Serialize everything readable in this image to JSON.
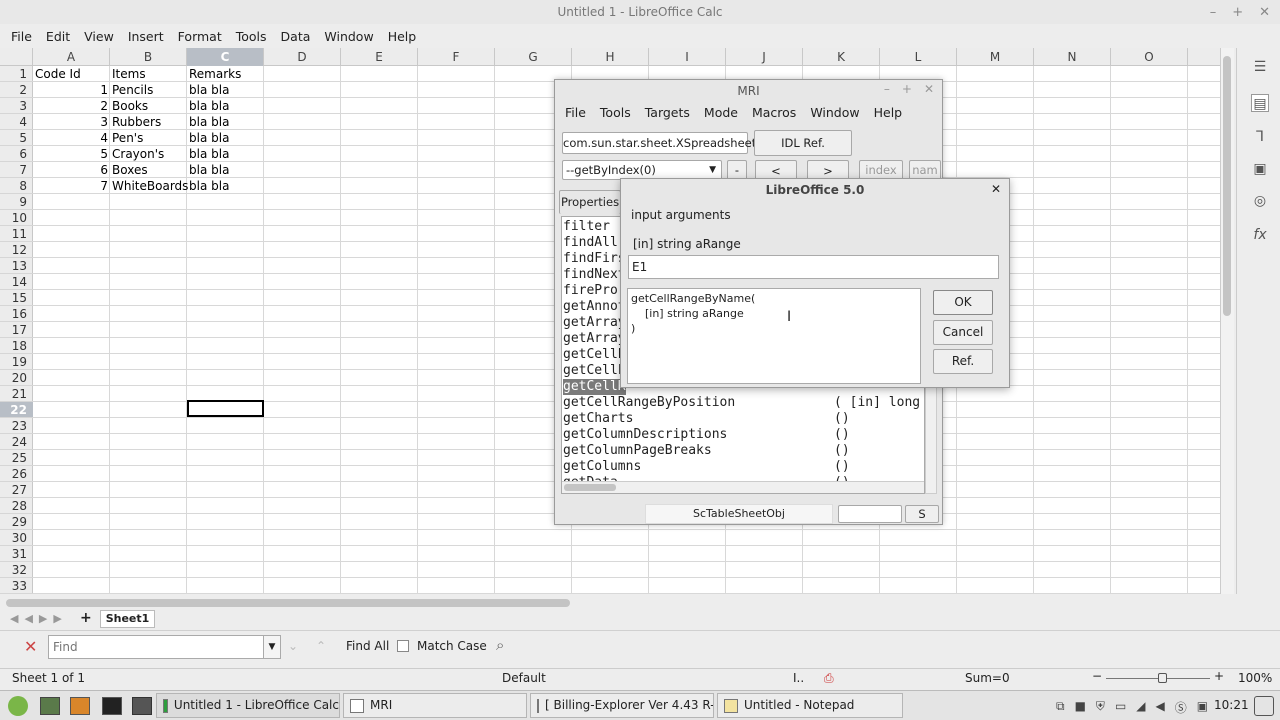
{
  "window": {
    "title": "Untitled 1 - LibreOffice Calc"
  },
  "menu": [
    "File",
    "Edit",
    "View",
    "Insert",
    "Format",
    "Tools",
    "Data",
    "Window",
    "Help"
  ],
  "columns": [
    "A",
    "B",
    "C",
    "D",
    "E",
    "F",
    "G",
    "H",
    "I",
    "J",
    "K",
    "L",
    "M",
    "N",
    "O"
  ],
  "selected_column": "C",
  "rows": [
    "1",
    "2",
    "3",
    "4",
    "5",
    "6",
    "7",
    "8",
    "9",
    "10",
    "11",
    "12",
    "13",
    "14",
    "15",
    "16",
    "17",
    "18",
    "19",
    "20",
    "21",
    "22",
    "23",
    "24",
    "25",
    "26",
    "27",
    "28",
    "29",
    "30",
    "31",
    "32",
    "33"
  ],
  "selected_row": "22",
  "sheet": {
    "headers": [
      "Code Id",
      "Items",
      "Remarks"
    ],
    "data": [
      [
        "1",
        "Pencils",
        "bla bla"
      ],
      [
        "2",
        "Books",
        "bla bla"
      ],
      [
        "3",
        "Rubbers",
        "bla bla"
      ],
      [
        "4",
        "Pen's",
        "bla bla"
      ],
      [
        "5",
        "Crayon's",
        "bla bla"
      ],
      [
        "6",
        "Boxes",
        "bla bla"
      ],
      [
        "7",
        "WhiteBoards",
        "bla bla"
      ]
    ]
  },
  "mri": {
    "title": "MRI",
    "menu": [
      "File",
      "Tools",
      "Targets",
      "Mode",
      "Macros",
      "Window",
      "Help"
    ],
    "type_name": "com.sun.star.sheet.XSpreadsheet",
    "idl_ref": "IDL Ref.",
    "combo": "--getByIndex(0)",
    "minus": "-",
    "nav_back": "<",
    "nav_fwd": ">",
    "index_btn": "index",
    "name_btn": "nam",
    "tab": "Properties",
    "list_left": [
      "filter",
      "findAll",
      "findFirs",
      "findNext",
      "firePror",
      "getAnnot",
      "getArray",
      "getArray",
      "getCellE",
      "getCellF",
      "getCellR"
    ],
    "list_rows": [
      {
        "name": "getCellRangeByPosition",
        "args": "( [in] long"
      },
      {
        "name": "getCharts",
        "args": "()"
      },
      {
        "name": "getColumnDescriptions",
        "args": "()"
      },
      {
        "name": "getColumnPageBreaks",
        "args": "()"
      },
      {
        "name": "getColumns",
        "args": "()"
      },
      {
        "name": "getData",
        "args": "()"
      }
    ],
    "status_text": "ScTableSheetObj",
    "status_btn": "S"
  },
  "dialog": {
    "title": "LibreOffice 5.0",
    "heading": "input arguments",
    "arg_label": "[in] string aRange",
    "input_value": "E1",
    "info_lines": [
      "getCellRangeByName(",
      "    [in] string aRange",
      ")"
    ],
    "ok": "OK",
    "cancel": "Cancel",
    "ref": "Ref."
  },
  "tabs": {
    "sheet1": "Sheet1"
  },
  "findbar": {
    "placeholder": "Find",
    "find_all": "Find All",
    "match_case": "Match Case"
  },
  "status": {
    "sheet": "Sheet 1 of 1",
    "style": "Default",
    "sum": "Sum=0",
    "zoom": "100%"
  },
  "taskbar": {
    "items": [
      "Untitled 1 - LibreOffice Calc",
      "MRI",
      "[ Billing-Explorer Ver 4.43 R-...",
      "Untitled - Notepad"
    ],
    "clock": "10:21"
  }
}
